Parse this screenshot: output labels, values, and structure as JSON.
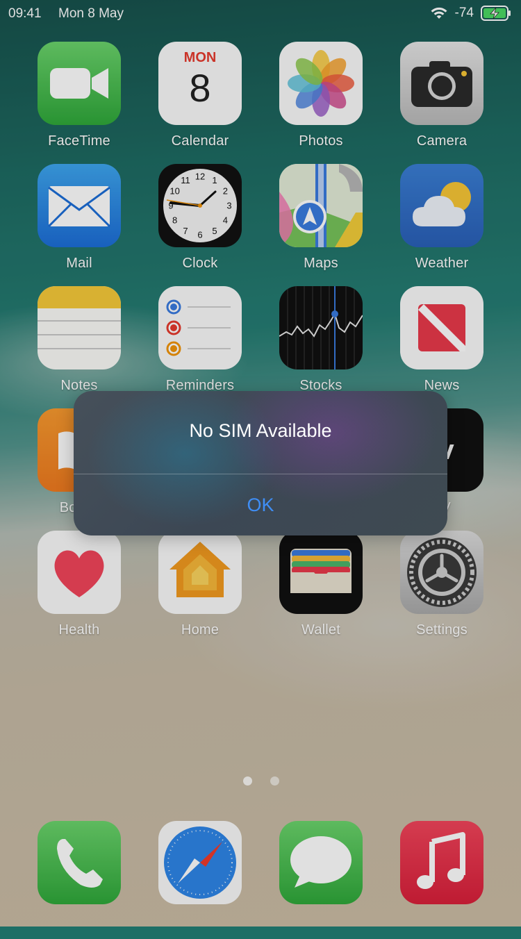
{
  "status_bar": {
    "time": "09:41",
    "date": "Mon 8 May",
    "signal": "-74"
  },
  "calendar": {
    "weekday": "MON",
    "day": "8"
  },
  "apps": [
    {
      "name": "FaceTime"
    },
    {
      "name": "Calendar"
    },
    {
      "name": "Photos"
    },
    {
      "name": "Camera"
    },
    {
      "name": "Mail"
    },
    {
      "name": "Clock"
    },
    {
      "name": "Maps"
    },
    {
      "name": "Weather"
    },
    {
      "name": "Notes"
    },
    {
      "name": "Reminders"
    },
    {
      "name": "Stocks"
    },
    {
      "name": "News"
    },
    {
      "name": "Books"
    },
    {
      "name": "TV"
    },
    {
      "name": "Health"
    },
    {
      "name": "Home"
    },
    {
      "name": "Wallet"
    },
    {
      "name": "Settings"
    }
  ],
  "dock": [
    {
      "name": "Phone"
    },
    {
      "name": "Safari"
    },
    {
      "name": "Messages"
    },
    {
      "name": "Music"
    }
  ],
  "alert": {
    "title": "No SIM Available",
    "button": "OK"
  },
  "tv_label": "tv",
  "clock_numbers": [
    "12",
    "1",
    "2",
    "3",
    "4",
    "5",
    "6",
    "7",
    "8",
    "9",
    "10",
    "11"
  ],
  "colors": {
    "accent": "#3f8ef5"
  }
}
